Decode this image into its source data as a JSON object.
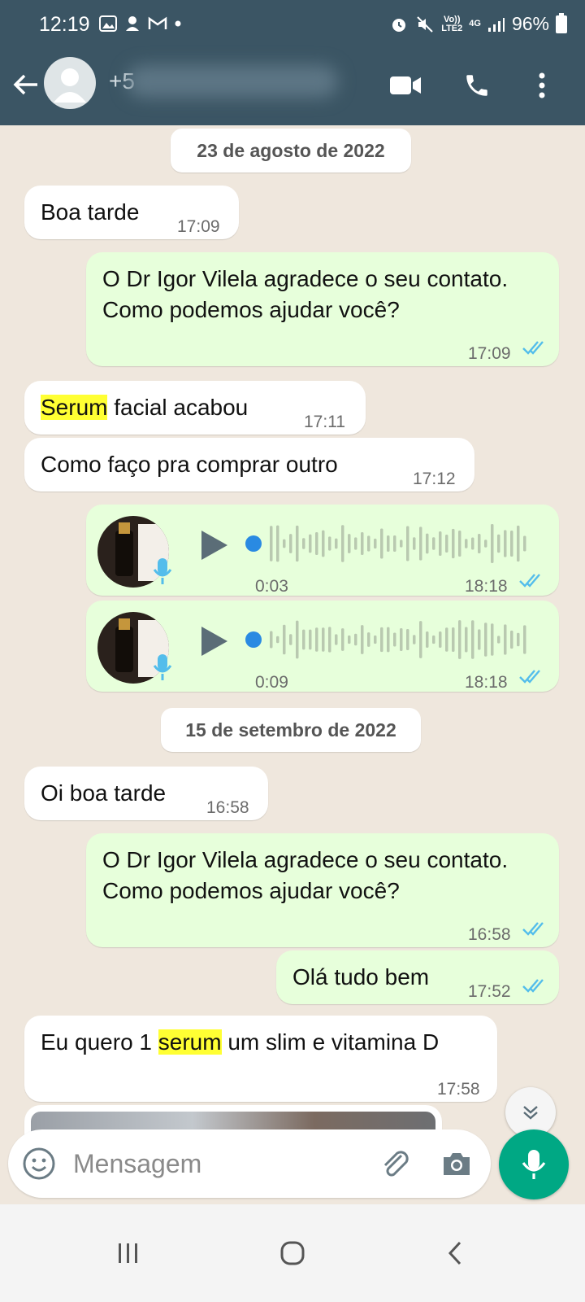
{
  "status_bar": {
    "time": "12:19",
    "network": "LTE2",
    "network_top": "Vo))",
    "network_type": "4G",
    "battery": "96%"
  },
  "header": {
    "contact_prefix": "+5"
  },
  "colors": {
    "header": "#3b5564",
    "incoming_bubble": "#ffffff",
    "outgoing_bubble": "#e7ffdb",
    "accent": "#00a884",
    "read_ticks": "#53bdeb",
    "highlight": "#ffff33"
  },
  "chat": {
    "date_1": "23 de agosto de 2022",
    "m1": {
      "text": "Boa tarde",
      "time": "17:09"
    },
    "m2": {
      "text": "O Dr Igor Vilela agradece o seu contato. Como podemos ajudar você?",
      "time": "17:09"
    },
    "m3": {
      "highlight": "Serum",
      "rest": " facial acabou",
      "time": "17:11"
    },
    "m4": {
      "text": "Como faço pra comprar outro",
      "time": "17:12"
    },
    "voice_1": {
      "duration": "0:03",
      "time": "18:18"
    },
    "voice_2": {
      "duration": "0:09",
      "time": "18:18"
    },
    "date_2": "15 de setembro de 2022",
    "m5": {
      "text": "Oi boa tarde",
      "time": "16:58"
    },
    "m6": {
      "text": "O Dr Igor Vilela agradece o seu contato. Como podemos ajudar você?",
      "time": "16:58"
    },
    "m7": {
      "text": "Olá tudo bem",
      "time": "17:52"
    },
    "m8": {
      "before": "Eu quero 1 ",
      "highlight": "serum",
      "after": " um slim e vitamina D",
      "time": "17:58"
    }
  },
  "composer": {
    "placeholder": "Mensagem"
  },
  "icons": [
    "back-arrow-icon",
    "avatar-icon",
    "video-call-icon",
    "phone-icon",
    "more-vert-icon",
    "emoji-icon",
    "attach-icon",
    "camera-icon",
    "mic-icon",
    "play-icon",
    "double-check-icon",
    "chevrons-down-icon"
  ]
}
